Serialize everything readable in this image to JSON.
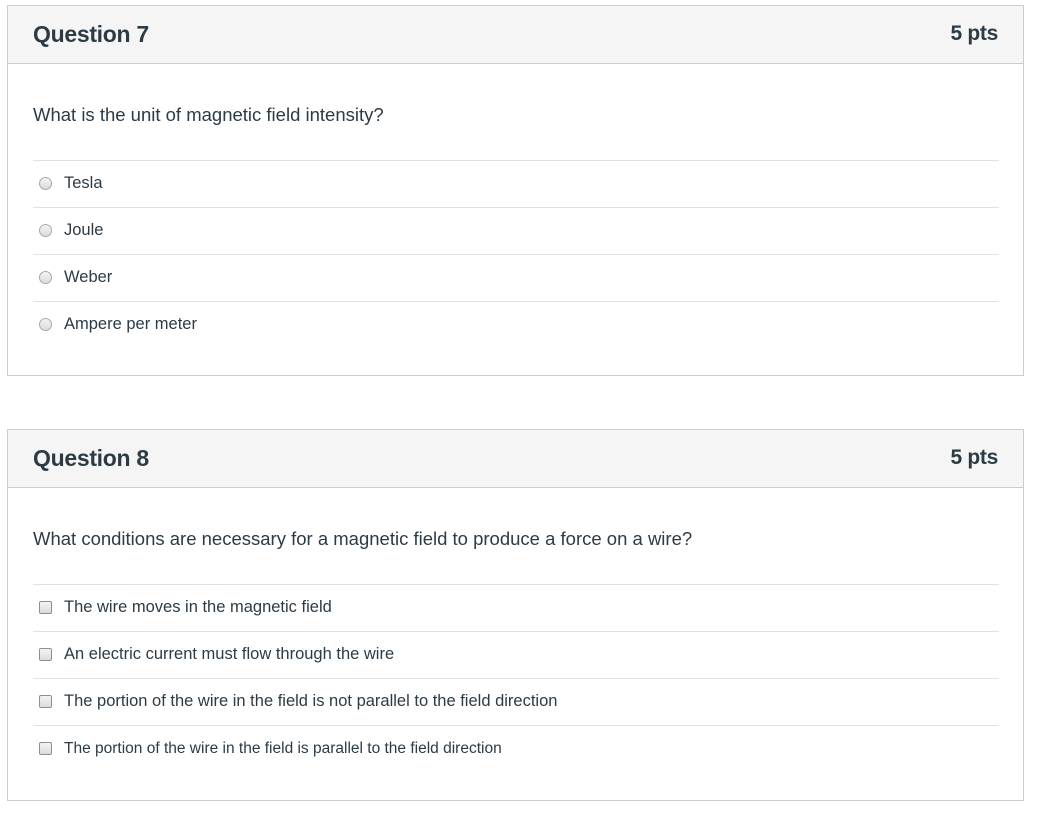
{
  "questions": [
    {
      "title": "Question 7",
      "points": "5 pts",
      "text": "What is the unit of magnetic field intensity?",
      "input_type": "radio",
      "answers": [
        "Tesla",
        "Joule",
        "Weber",
        "Ampere per meter"
      ]
    },
    {
      "title": "Question 8",
      "points": "5 pts",
      "text": "What conditions are necessary for a magnetic field to produce a force on a wire?",
      "input_type": "checkbox",
      "answers": [
        "The wire moves in the magnetic field",
        "An electric current must flow through the wire",
        "The portion of the wire in the field is not parallel to the field direction",
        "The portion of the wire in the field is parallel to the field direction"
      ]
    }
  ]
}
